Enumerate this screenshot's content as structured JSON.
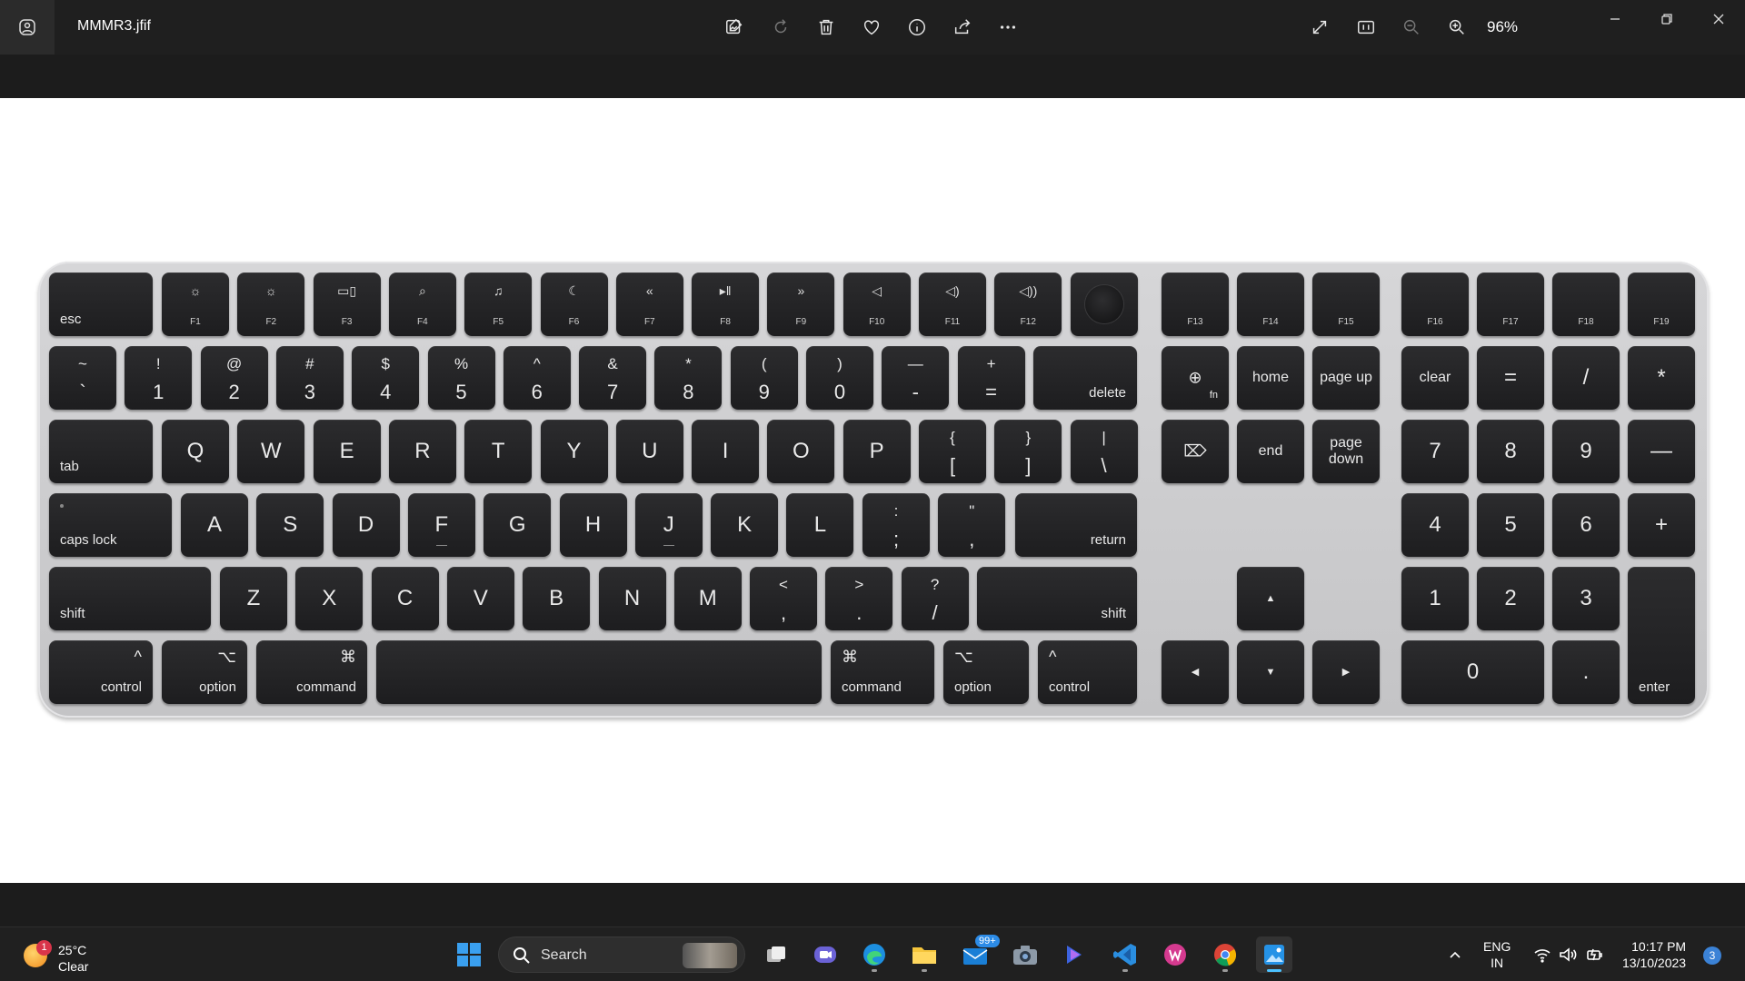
{
  "titlebar": {
    "filename": "MMMR3.jfif",
    "zoom": "96%",
    "toolbar_icons": [
      "edit-image-icon",
      "rotate-icon",
      "delete-icon",
      "favorite-icon",
      "info-icon",
      "share-icon",
      "more-icon"
    ],
    "view_icons": [
      "fit-to-window-icon",
      "actual-size-icon",
      "zoom-out-icon",
      "zoom-in-icon"
    ],
    "window_controls": [
      "minimize-icon",
      "restore-icon",
      "close-icon"
    ]
  },
  "keyboard": {
    "function_row": {
      "esc": "esc",
      "fkeys": [
        "F1",
        "F2",
        "F3",
        "F4",
        "F5",
        "F6",
        "F7",
        "F8",
        "F9",
        "F10",
        "F11",
        "F12"
      ],
      "fkey_icons": [
        "☼",
        "☼",
        "▭▯",
        "⌕",
        "♫",
        "☾",
        "«",
        "▸‖",
        "»",
        "◁",
        "◁)",
        "◁))"
      ],
      "extra": [
        "F13",
        "F14",
        "F15",
        "F16",
        "F17",
        "F18",
        "F19"
      ]
    },
    "number_row": [
      {
        "top": "~",
        "bot": "`"
      },
      {
        "top": "!",
        "bot": "1"
      },
      {
        "top": "@",
        "bot": "2"
      },
      {
        "top": "#",
        "bot": "3"
      },
      {
        "top": "$",
        "bot": "4"
      },
      {
        "top": "%",
        "bot": "5"
      },
      {
        "top": "^",
        "bot": "6"
      },
      {
        "top": "&",
        "bot": "7"
      },
      {
        "top": "*",
        "bot": "8"
      },
      {
        "top": "(",
        "bot": "9"
      },
      {
        "top": ")",
        "bot": "0"
      },
      {
        "top": "—",
        "bot": "-"
      },
      {
        "top": "+",
        "bot": "="
      }
    ],
    "delete": "delete",
    "tab": "tab",
    "qwerty": [
      "Q",
      "W",
      "E",
      "R",
      "T",
      "Y",
      "U",
      "I",
      "O",
      "P"
    ],
    "brackets": [
      {
        "top": "{",
        "bot": "["
      },
      {
        "top": "}",
        "bot": "]"
      },
      {
        "top": "|",
        "bot": "\\"
      }
    ],
    "caps_lock": "caps lock",
    "asdf": [
      "A",
      "S",
      "D",
      "F",
      "G",
      "H",
      "J",
      "K",
      "L"
    ],
    "semi": [
      {
        "top": ":",
        "bot": ";"
      },
      {
        "top": "\"",
        "bot": ","
      }
    ],
    "return": "return",
    "shift": "shift",
    "zxcv": [
      "Z",
      "X",
      "C",
      "V",
      "B",
      "N",
      "M"
    ],
    "punct": [
      {
        "top": "<",
        "bot": ","
      },
      {
        "top": ">",
        "bot": "."
      },
      {
        "top": "?",
        "bot": "/"
      }
    ],
    "control": "control",
    "option": "option",
    "command": "command",
    "control_sym": "^",
    "option_sym": "⌥",
    "command_sym": "⌘",
    "nav": {
      "fn": "fn",
      "home": "home",
      "page_up": "page up",
      "end": "end",
      "page_down": "page down"
    },
    "arrows": {
      "up": "▲",
      "down": "▼",
      "left": "◀",
      "right": "▶"
    },
    "numpad": {
      "clear": "clear",
      "eq": "=",
      "div": "/",
      "mul": "*",
      "n7": "7",
      "n8": "8",
      "n9": "9",
      "minus": "—",
      "n4": "4",
      "n5": "5",
      "n6": "6",
      "plus": "+",
      "n1": "1",
      "n2": "2",
      "n3": "3",
      "n0": "0",
      "dot": ".",
      "enter": "enter"
    }
  },
  "taskbar": {
    "weather": {
      "badge": "1",
      "temp": "25°C",
      "condition": "Clear"
    },
    "search": {
      "label": "Search"
    },
    "mail_badge": "99+",
    "lang": {
      "line1": "ENG",
      "line2": "IN"
    },
    "clock": {
      "time": "10:17 PM",
      "date": "13/10/2023"
    },
    "notifications": "3"
  }
}
